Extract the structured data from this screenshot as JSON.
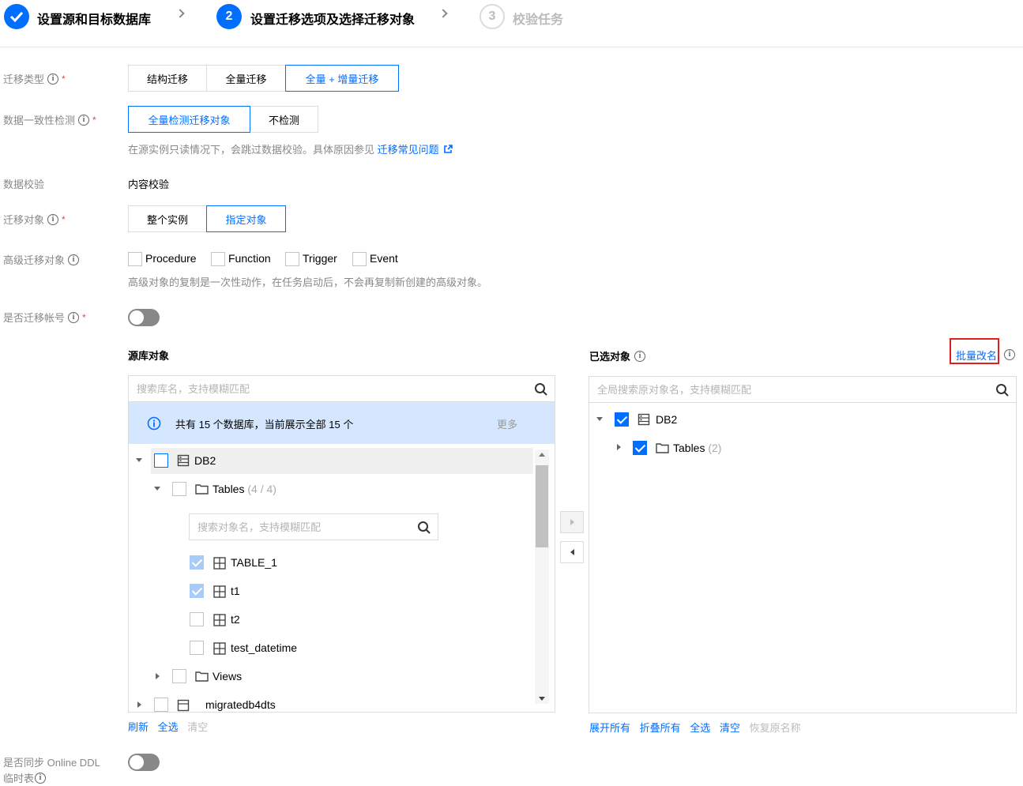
{
  "steps": [
    {
      "label": "设置源和目标数据库",
      "status": "done"
    },
    {
      "number": "2",
      "label": "设置迁移选项及选择迁移对象",
      "status": "active"
    },
    {
      "number": "3",
      "label": "校验任务",
      "status": "pending"
    }
  ],
  "form": {
    "migration_type": {
      "label": "迁移类型",
      "options": [
        "结构迁移",
        "全量迁移",
        "全量 + 增量迁移"
      ],
      "selected": "全量 + 增量迁移"
    },
    "consistency_check": {
      "label": "数据一致性检测",
      "options": [
        "全量检测迁移对象",
        "不检测"
      ],
      "selected": "全量检测迁移对象",
      "hint": "在源实例只读情况下，会跳过数据校验。具体原因参见",
      "hint_link": "迁移常见问题"
    },
    "data_check": {
      "label": "数据校验",
      "value": "内容校验"
    },
    "migration_object": {
      "label": "迁移对象",
      "options": [
        "整个实例",
        "指定对象"
      ],
      "selected": "指定对象"
    },
    "advanced_objects": {
      "label": "高级迁移对象",
      "options": [
        "Procedure",
        "Function",
        "Trigger",
        "Event"
      ],
      "hint": "高级对象的复制是一次性动作，在任务启动后，不会再复制新创建的高级对象。"
    },
    "migrate_accounts": {
      "label": "是否迁移帐号",
      "enabled": false
    },
    "online_ddl": {
      "label_line1": "是否同步 Online DDL",
      "label_line2": "临时表",
      "enabled": false
    }
  },
  "source_panel": {
    "title": "源库对象",
    "search_placeholder": "搜索库名，支持模糊匹配",
    "banner_text": "共有 15 个数据库，当前展示全部 15 个",
    "banner_more": "更多",
    "tree": {
      "db_name": "DB2",
      "tables_label": "Tables",
      "tables_count": "(4 / 4)",
      "object_search_placeholder": "搜索对象名，支持模糊匹配",
      "tables": [
        {
          "name": "TABLE_1",
          "checked": true
        },
        {
          "name": "t1",
          "checked": true
        },
        {
          "name": "t2",
          "checked": false
        },
        {
          "name": "test_datetime",
          "checked": false
        }
      ],
      "views_label": "Views",
      "next_db": "migratedb4dts"
    },
    "links": {
      "refresh": "刷新",
      "select_all": "全选",
      "clear": "清空"
    }
  },
  "selected_panel": {
    "title": "已选对象",
    "batch_rename": "批量改名",
    "search_placeholder": "全局搜索原对象名，支持模糊匹配",
    "tree": {
      "db_name": "DB2",
      "tables_label": "Tables",
      "tables_count": "(2)"
    },
    "links": {
      "expand_all": "展开所有",
      "collapse_all": "折叠所有",
      "select_all": "全选",
      "clear": "清空",
      "restore_names": "恢复原名称"
    }
  },
  "colors": {
    "accent": "#006eff",
    "highlight_box": "#e02020",
    "banner_bg": "#d5e7ff"
  }
}
